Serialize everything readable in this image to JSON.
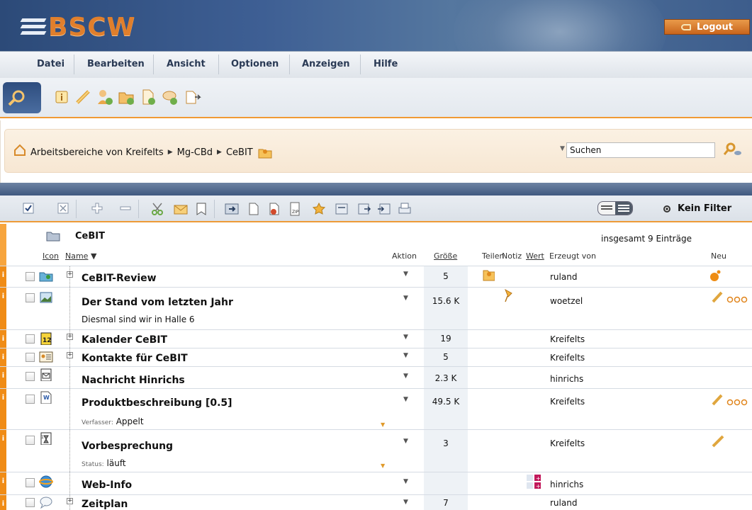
{
  "header": {
    "logo_text": "BSCW",
    "logout_label": "Logout"
  },
  "menu": [
    "Datei",
    "Bearbeiten",
    "Ansicht",
    "Optionen",
    "Anzeigen",
    "Hilfe"
  ],
  "breadcrumb": {
    "items": [
      "Arbeitsbereiche von Kreifelts",
      "Mg-CBd",
      "CeBIT"
    ]
  },
  "search": {
    "value": "Suchen"
  },
  "filter": {
    "label": "Kein Filter"
  },
  "folder": {
    "name": "CeBIT",
    "total": "insgesamt 9 Einträge"
  },
  "columns": {
    "icon": "Icon",
    "name": "Name",
    "action": "Aktion",
    "size": "Größe",
    "share": "Teilen",
    "note": "Notiz",
    "value": "Wert",
    "creator": "Erzeugt von",
    "new": "Neu"
  },
  "entries": [
    {
      "name": "CeBIT-Review",
      "size": "5",
      "owner": "ruland",
      "icon": "shared-folder-icon",
      "expandable": true
    },
    {
      "name": "Der Stand vom letzten Jahr",
      "desc": "Diesmal sind wir in Halle 6",
      "size": "15.6 K",
      "owner": "woetzel",
      "icon": "image-file-icon"
    },
    {
      "name": "Kalender CeBIT",
      "size": "19",
      "owner": "Kreifelts",
      "icon": "calendar-icon",
      "expandable": true
    },
    {
      "name": "Kontakte für CeBIT",
      "size": "5",
      "owner": "Kreifelts",
      "icon": "contacts-icon",
      "expandable": true
    },
    {
      "name": "Nachricht Hinrichs",
      "size": "2.3 K",
      "owner": "hinrichs",
      "icon": "message-icon"
    },
    {
      "name": "Produktbeschreibung [0.5]",
      "meta_label": "Verfasser:",
      "meta_value": "Appelt",
      "size": "49.5 K",
      "owner": "Kreifelts",
      "icon": "word-document-icon"
    },
    {
      "name": "Vorbesprechung",
      "meta_label": "Status:",
      "meta_value": "läuft",
      "size": "3",
      "owner": "Kreifelts",
      "icon": "appointment-icon"
    },
    {
      "name": "Web-Info",
      "size": "",
      "owner": "hinrichs",
      "icon": "web-link-icon"
    },
    {
      "name": "Zeitplan",
      "size": "7",
      "owner": "ruland",
      "icon": "discussion-icon",
      "expandable": true
    }
  ],
  "colors": {
    "accent_orange": "#f08c16",
    "header_blue": "#3e5f94"
  }
}
